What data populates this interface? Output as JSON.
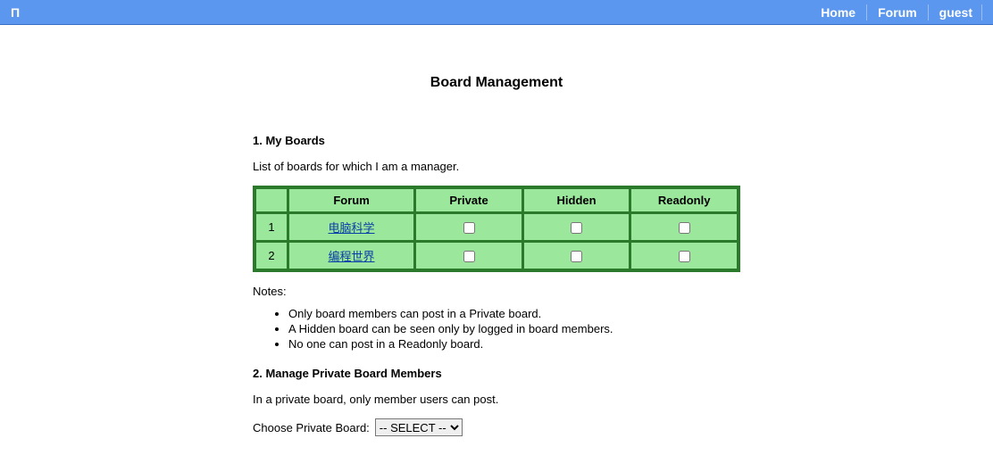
{
  "topbar": {
    "logo": "Π",
    "links": [
      "Home",
      "Forum",
      "guest"
    ]
  },
  "page": {
    "title": "Board Management"
  },
  "section1": {
    "heading": "1. My Boards",
    "desc": "List of boards for which I am a manager.",
    "table": {
      "headers": [
        "Forum",
        "Private",
        "Hidden",
        "Readonly"
      ],
      "rows": [
        {
          "num": "1",
          "forum": "电脑科学",
          "private": false,
          "hidden": false,
          "readonly": false
        },
        {
          "num": "2",
          "forum": "编程世界",
          "private": false,
          "hidden": false,
          "readonly": false
        }
      ]
    },
    "notes_label": "Notes:",
    "notes": [
      "Only board members can post in a Private board.",
      "A Hidden board can be seen only by logged in board members.",
      "No one can post in a Readonly board."
    ]
  },
  "section2": {
    "heading": "2. Manage Private Board Members",
    "desc": "In a private board, only member users can post.",
    "choose_label": "Choose Private Board:",
    "select_placeholder": "-- SELECT --"
  }
}
